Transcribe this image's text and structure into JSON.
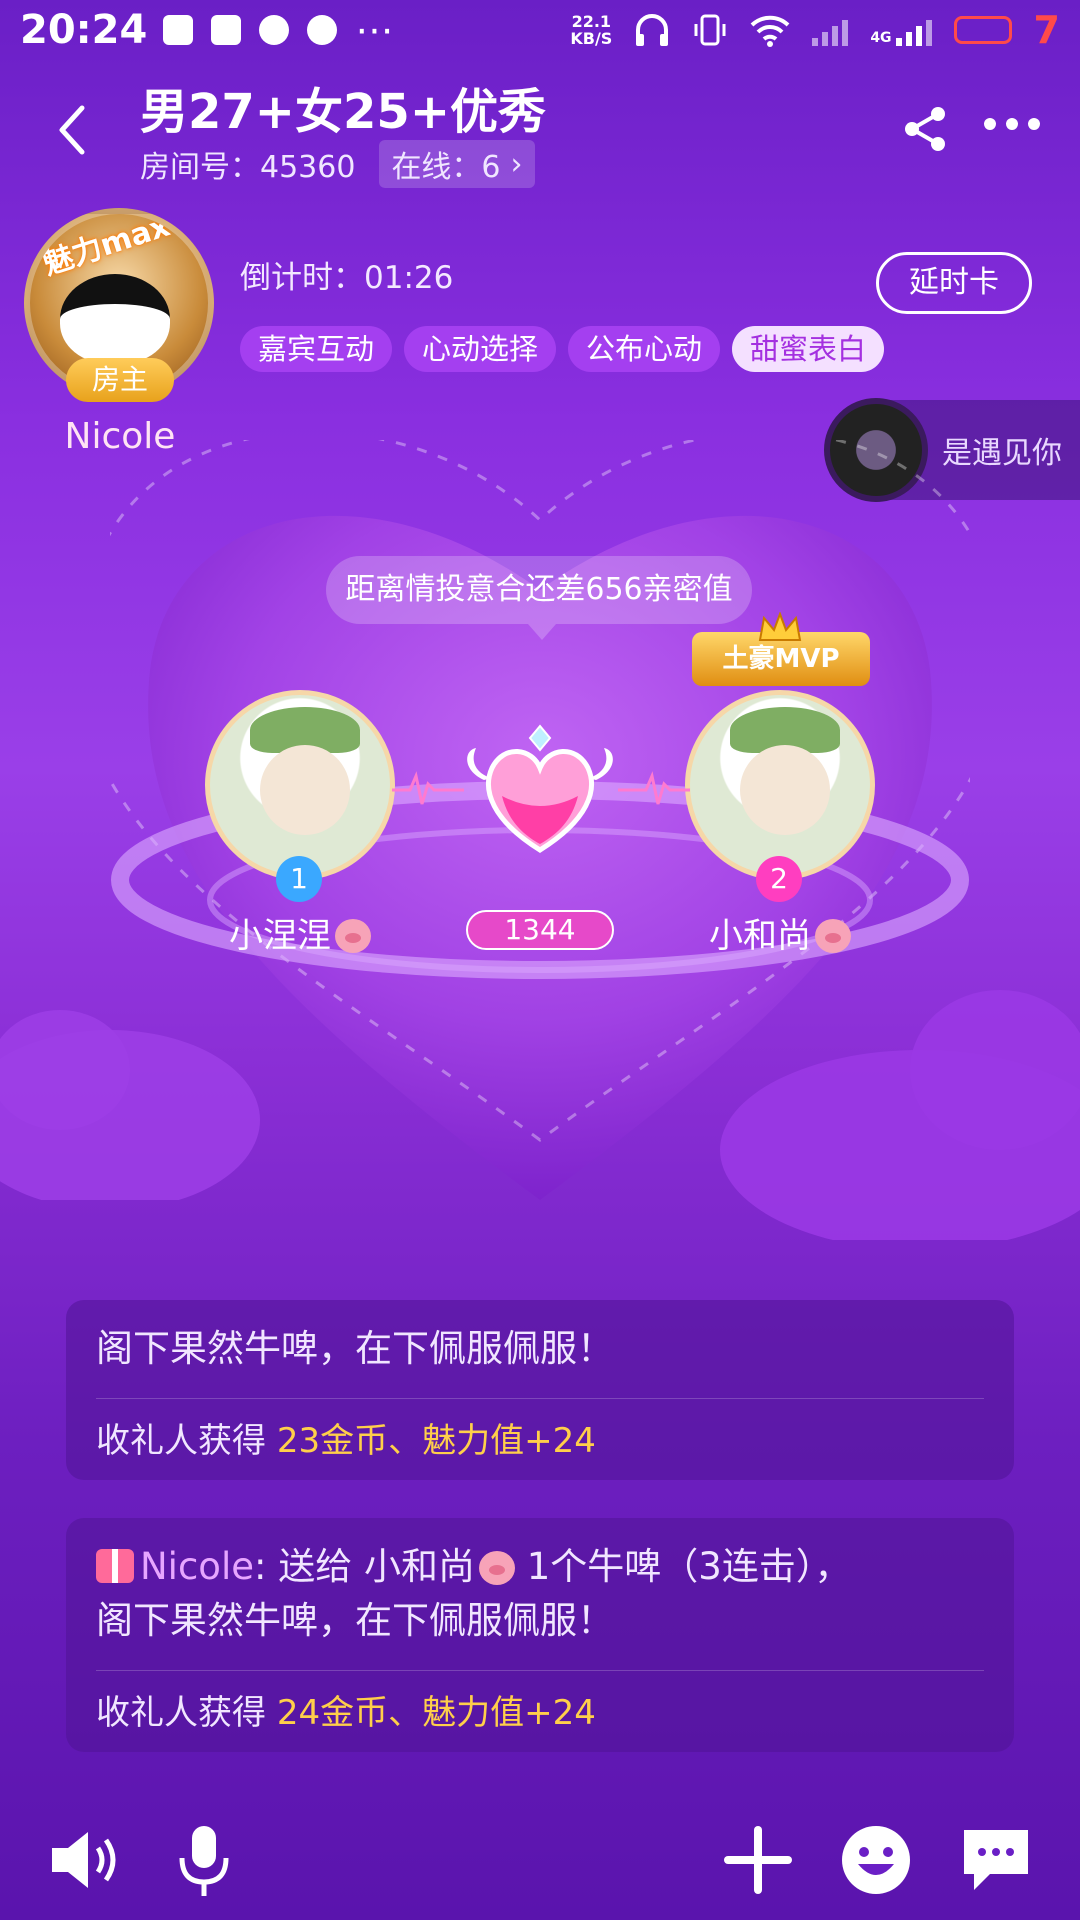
{
  "status_bar": {
    "time": "20:24",
    "net_speed_value": "22.1",
    "net_speed_unit": "KB/S",
    "net_type": "4G",
    "battery": "7"
  },
  "room": {
    "title": "男27+女25+优秀",
    "room_no_label": "房间号：45360",
    "online_label": "在线：6"
  },
  "host": {
    "badge": "魅力max",
    "role": "房主",
    "name": "Nicole"
  },
  "countdown": "倒计时：01:26",
  "delay_button": "延时卡",
  "stages": [
    "嘉宾互动",
    "心动选择",
    "公布心动",
    "甜蜜表白"
  ],
  "active_stage_index": 3,
  "mini_player": {
    "text": "是遇见你"
  },
  "tip": "距离情投意合还差656亲密值",
  "guests": [
    {
      "seat": "1",
      "name": "小涅涅",
      "seat_color": "#3aa8ff"
    },
    {
      "seat": "2",
      "name": "小和尚",
      "seat_color": "#ff3ec0"
    }
  ],
  "mvp_label": "土豪MVP",
  "intimacy_score": "1344",
  "messages": [
    {
      "line1_visible": "阁下果然牛啤，在下佩服佩服！",
      "reward_prefix": "收礼人获得 ",
      "reward_value": "23金币、魅力值+24"
    },
    {
      "sender": "Nicole",
      "body": ": 送给 小和尚",
      "body2": " 1个牛啤（3连击），",
      "line2": "阁下果然牛啤，在下佩服佩服！",
      "reward_prefix": "收礼人获得 ",
      "reward_value": "24金币、魅力值+24"
    }
  ],
  "colors": {
    "bg_top": "#6a1fc6",
    "bg_bottom": "#5a14ad",
    "stage_active_bg": "#f4e0ff",
    "gold_text": "#ffcf4a",
    "score_bg": "#e649c9"
  }
}
